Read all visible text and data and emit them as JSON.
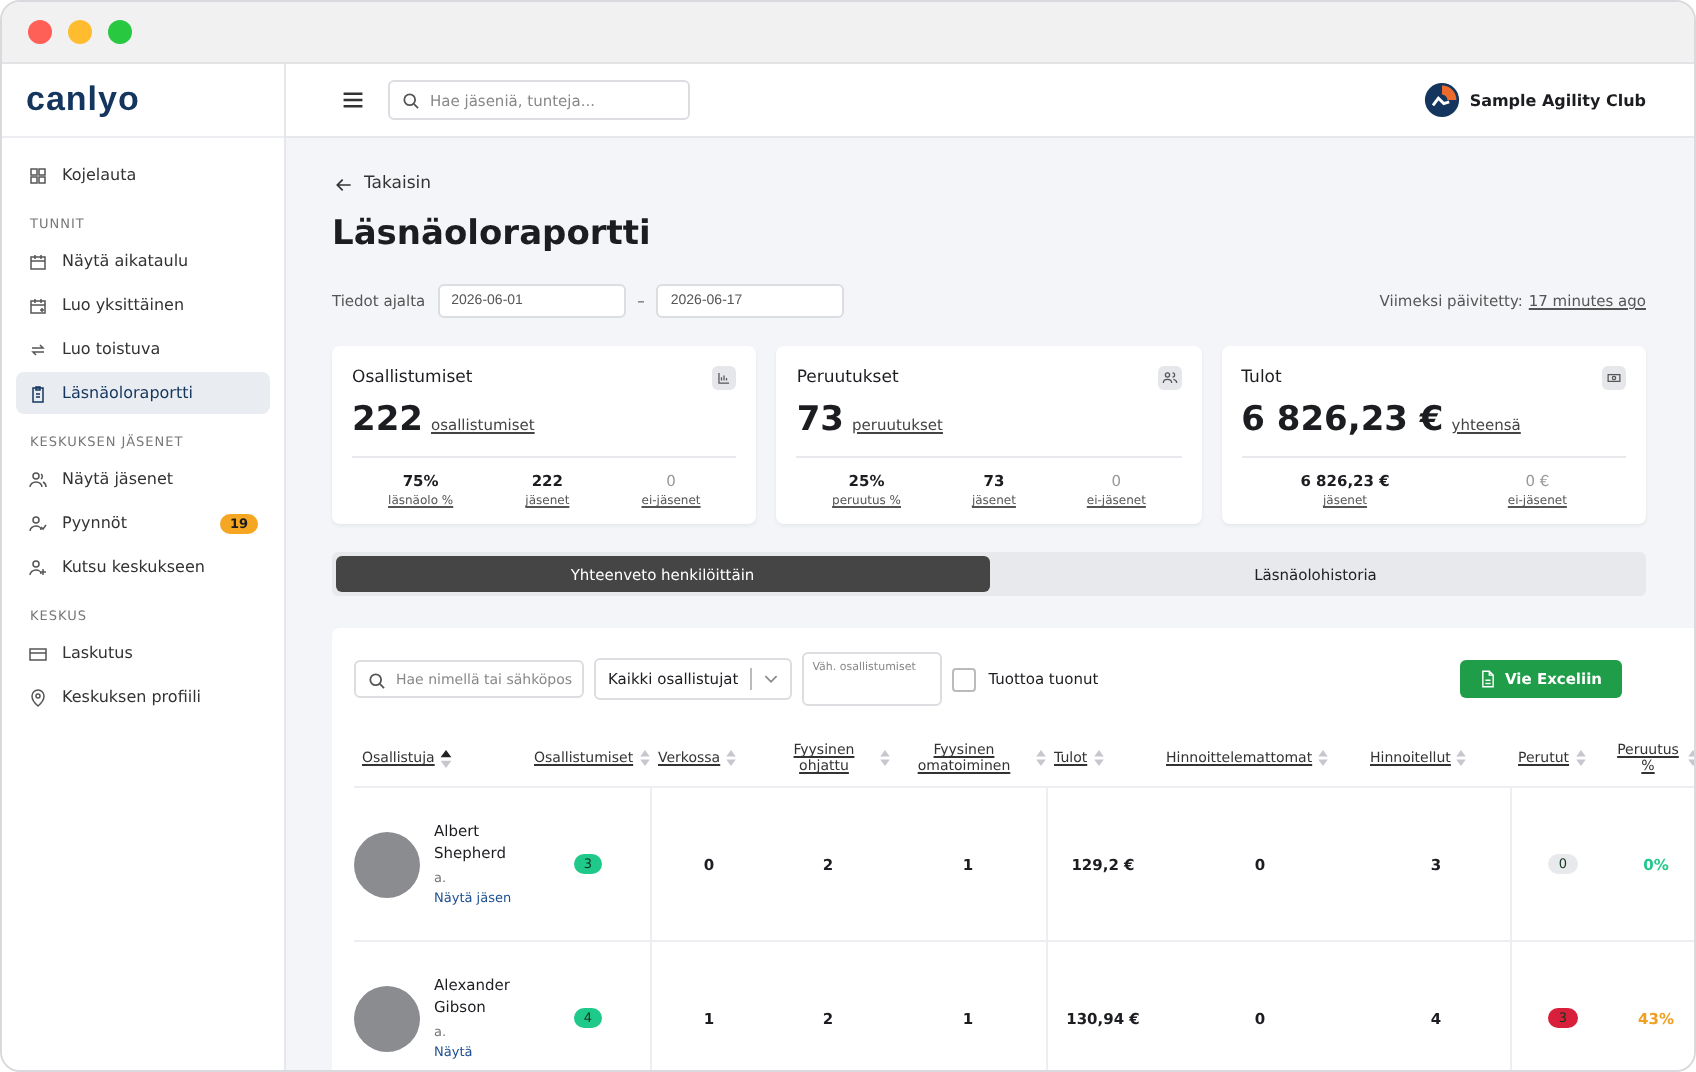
{
  "brand": {
    "logo": "canlyo"
  },
  "sidebar": {
    "groups": [
      {
        "items": [
          {
            "label": "Kojelauta",
            "selected": false
          }
        ]
      },
      {
        "heading": "TUNNIT",
        "items": [
          {
            "label": "Näytä aikataulu",
            "selected": false
          },
          {
            "label": "Luo yksittäinen",
            "selected": false
          },
          {
            "label": "Luo toistuva",
            "selected": false
          },
          {
            "label": "Läsnäoloraportti",
            "selected": true
          }
        ]
      },
      {
        "heading": "KESKUKSEN JÄSENET",
        "items": [
          {
            "label": "Näytä jäsenet",
            "selected": false
          },
          {
            "label": "Pyynnöt",
            "selected": false,
            "badge": "19"
          },
          {
            "label": "Kutsu keskukseen",
            "selected": false
          }
        ]
      },
      {
        "heading": "KESKUS",
        "items": [
          {
            "label": "Laskutus",
            "selected": false
          },
          {
            "label": "Keskuksen profiili",
            "selected": false
          }
        ]
      }
    ]
  },
  "topbar": {
    "search": {
      "placeholder": "Hae jäseniä, tunteja..."
    },
    "club": "Sample Agility Club"
  },
  "page": {
    "back": "Takaisin",
    "title": "Läsnäoloraportti",
    "range": {
      "label": "Tiedot ajalta",
      "from": "2026-06-01",
      "separator": "–",
      "to": "2026-06-17"
    },
    "updated": {
      "label": "Viimeksi päivitetty:",
      "value": "17 minutes ago"
    }
  },
  "cards": [
    {
      "title": "Osallistumiset",
      "value": "222",
      "unit": "osallistumiset",
      "stats": [
        {
          "value": "75%",
          "label": "läsnäolo %",
          "muted": false
        },
        {
          "value": "222",
          "label": "jäsenet",
          "muted": false
        },
        {
          "value": "0",
          "label": "ei-jäsenet",
          "muted": true
        }
      ]
    },
    {
      "title": "Peruutukset",
      "value": "73",
      "unit": "peruutukset",
      "stats": [
        {
          "value": "25%",
          "label": "peruutus %",
          "muted": false
        },
        {
          "value": "73",
          "label": "jäsenet",
          "muted": false
        },
        {
          "value": "0",
          "label": "ei-jäsenet",
          "muted": true
        }
      ]
    },
    {
      "title": "Tulot",
      "value": "6 826,23 €",
      "unit": "yhteensä",
      "stats": [
        {
          "value": "6 826,23 €",
          "label": "jäsenet",
          "muted": false
        },
        {
          "value": "0 €",
          "label": "ei-jäsenet",
          "muted": true
        }
      ]
    }
  ],
  "tabs": [
    {
      "label": "Yhteenveto henkilöittäin",
      "selected": true
    },
    {
      "label": "Läsnäolohistoria",
      "selected": false
    }
  ],
  "toolbar": {
    "search": {
      "placeholder": "Hae nimellä tai sähköpos"
    },
    "filter": {
      "value": "Kaikki osallistujat"
    },
    "min_field": {
      "placeholder": "Väh. osallistumiset"
    },
    "checkbox": {
      "label": "Tuottoa tuonut",
      "checked": false
    },
    "export": "Vie Exceliin"
  },
  "table": {
    "columns": [
      {
        "label": "Osallistuja",
        "sorted": true
      },
      {
        "label": "Osallistumiset",
        "sorted": false
      },
      {
        "label": "Verkossa",
        "sorted": false
      },
      {
        "label": "Fyysinen ohjattu",
        "sorted": false
      },
      {
        "label": "Fyysinen omatoiminen",
        "sorted": false
      },
      {
        "label": "Tulot",
        "sorted": false
      },
      {
        "label": "Hinnoittelemattomat",
        "sorted": false
      },
      {
        "label": "Hinnoitellut",
        "sorted": false
      },
      {
        "label": "Perutut",
        "sorted": false
      },
      {
        "label": "Peruutus %",
        "sorted": false
      }
    ],
    "rows": [
      {
        "cells": [
          {
            "kind": "person",
            "name": "Albert Shepherd",
            "email": "a.",
            "link": "Näytä jäsen"
          },
          {
            "kind": "pill",
            "value": "3",
            "color": "#1fc98a"
          },
          {
            "kind": "number",
            "value": "0"
          },
          {
            "kind": "number",
            "value": "2"
          },
          {
            "kind": "number",
            "value": "1"
          },
          {
            "kind": "number",
            "value": "129,2 €"
          },
          {
            "kind": "number",
            "value": "0"
          },
          {
            "kind": "number",
            "value": "3"
          },
          {
            "kind": "pill",
            "value": "0",
            "color": "#e8e9ec"
          },
          {
            "kind": "rate",
            "value": "0%",
            "color": "#1fc98a"
          }
        ]
      },
      {
        "cells": [
          {
            "kind": "person",
            "name": "Alexander Gibson",
            "email": "a.",
            "link": "Näytä"
          },
          {
            "kind": "pill",
            "value": "4",
            "color": "#1fc98a"
          },
          {
            "kind": "number",
            "value": "1"
          },
          {
            "kind": "number",
            "value": "2"
          },
          {
            "kind": "number",
            "value": "1"
          },
          {
            "kind": "number",
            "value": "130,94 €"
          },
          {
            "kind": "number",
            "value": "0"
          },
          {
            "kind": "number",
            "value": "4"
          },
          {
            "kind": "pill",
            "value": "3",
            "color": "#d8203c"
          },
          {
            "kind": "rate",
            "value": "43%",
            "color": "#f0a020"
          }
        ]
      }
    ]
  }
}
